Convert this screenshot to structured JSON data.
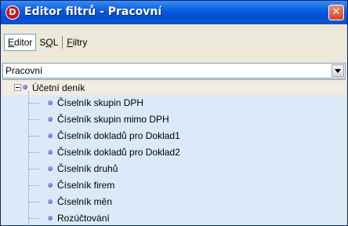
{
  "window": {
    "title": "Editor filtrů - Pracovní",
    "icon_glyph": "D",
    "close_glyph": "✕"
  },
  "tabs": [
    {
      "label_first": "E",
      "label_rest": "ditor"
    },
    {
      "label_pre": "S",
      "label_underlined": "Q",
      "label_post": "L"
    },
    {
      "label_first": "F",
      "label_rest": "iltry"
    }
  ],
  "combo": {
    "value": "Pracovní"
  },
  "tree": {
    "root": {
      "label": "Účetní deník"
    },
    "items": [
      {
        "label": "Číselník skupin DPH"
      },
      {
        "label": "Číselník skupin mimo  DPH"
      },
      {
        "label": "Číselník dokladů pro Doklad1"
      },
      {
        "label": "Číselník dokladů pro Doklad2"
      },
      {
        "label": "Číselník druhů"
      },
      {
        "label": "Číselník firem"
      },
      {
        "label": "Číselník měn"
      },
      {
        "label": "Rozúčtování"
      }
    ]
  }
}
